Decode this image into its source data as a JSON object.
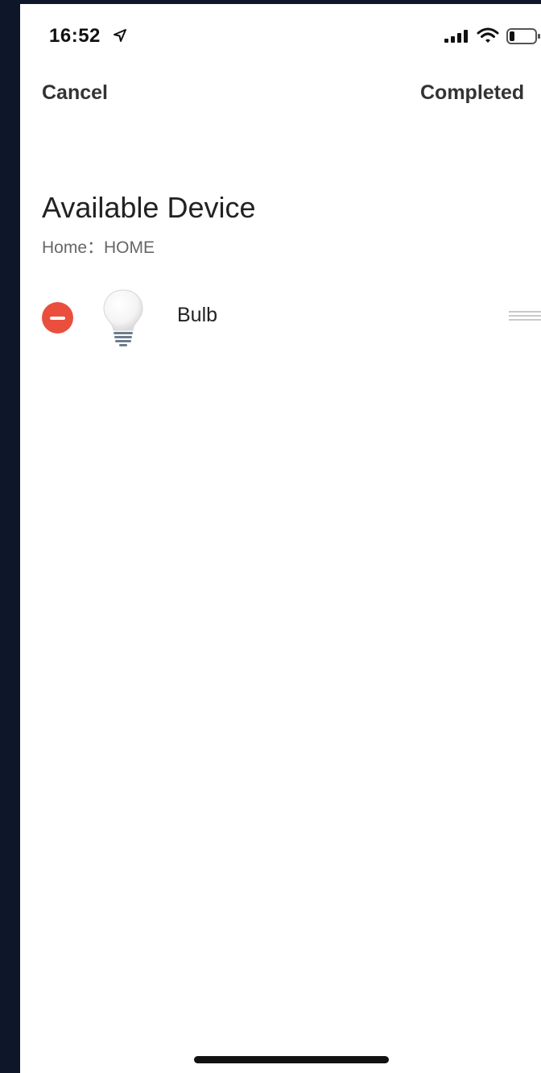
{
  "status_bar": {
    "time": "16:52",
    "icons": [
      "location-icon",
      "signal-icon",
      "wifi-icon",
      "battery-icon"
    ]
  },
  "nav": {
    "cancel_label": "Cancel",
    "completed_label": "Completed"
  },
  "section": {
    "title": "Available Device",
    "home_line": "Home：HOME"
  },
  "devices": [
    {
      "name": "Bulb",
      "icon": "bulb-icon",
      "action_icon": "remove-icon",
      "handle_icon": "drag-handle-icon"
    }
  ],
  "colors": {
    "remove": "#ea4f3d",
    "outer_background": "#0e1729"
  }
}
